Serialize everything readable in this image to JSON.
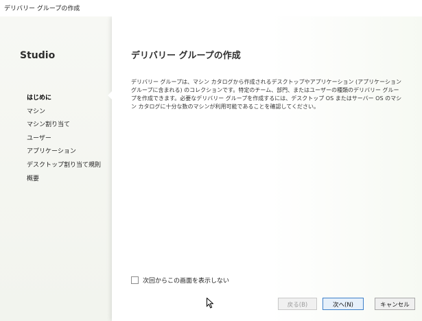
{
  "window": {
    "title": "デリバリー グループの作成"
  },
  "sidebar": {
    "app_name": "Studio",
    "items": [
      {
        "label": "はじめに",
        "active": true
      },
      {
        "label": "マシン",
        "active": false
      },
      {
        "label": "マシン割り当て",
        "active": false
      },
      {
        "label": "ユーザー",
        "active": false
      },
      {
        "label": "アプリケーション",
        "active": false
      },
      {
        "label": "デスクトップ割り当て規則",
        "active": false
      },
      {
        "label": "概要",
        "active": false
      }
    ]
  },
  "main": {
    "title": "デリバリー グループの作成",
    "description": "デリバリー グループは、マシン カタログから作成されるデスクトップやアプリケーション (アプリケーション グループに含まれる) のコレクションです。特定のチーム、部門、またはユーザーの種類のデリバリー グループを作成できます。必要なデリバリー グループを作成するには、デスクトップ OS またはサーバー OS のマシン カタログに十分な数のマシンが利用可能であることを確認してください。",
    "checkbox": {
      "label": "次回からこの画面を表示しない",
      "checked": false
    }
  },
  "footer": {
    "back_label": "戻る(B)",
    "next_label": "次へ(N)",
    "cancel_label": "キャンセル"
  },
  "colors": {
    "accent_border": "#3c7fc9",
    "background_tint": "#e3ecd6",
    "disabled_text": "#9a9a9a"
  },
  "icons": {
    "cursor": "mouse-pointer-icon",
    "notch": "nav-pointer-notch"
  }
}
